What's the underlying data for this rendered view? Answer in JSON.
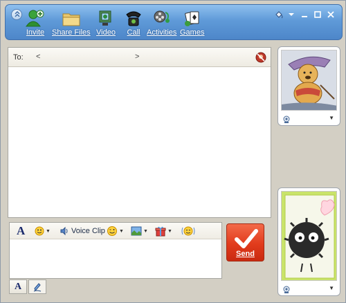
{
  "toolbar": {
    "buttons": [
      {
        "id": "invite",
        "label": "Invite",
        "icon": "add-contact-icon"
      },
      {
        "id": "share",
        "label": "Share Files",
        "icon": "folder-icon"
      },
      {
        "id": "video",
        "label": "Video",
        "icon": "video-icon"
      },
      {
        "id": "call",
        "label": "Call",
        "icon": "phone-icon"
      },
      {
        "id": "activities",
        "label": "Activities",
        "icon": "film-reel-icon"
      },
      {
        "id": "games",
        "label": "Games",
        "icon": "cards-icon"
      }
    ],
    "colors": {
      "top": "#8fc0ee",
      "bottom": "#4d86c9"
    }
  },
  "to_bar": {
    "label": "To:",
    "contact_open": "<",
    "contact_close": ">"
  },
  "format_bar": {
    "font_label": "A",
    "voice_clip_label": "Voice Clip"
  },
  "mode_tabs": {
    "text_mode": "A"
  },
  "send": {
    "label": "Send",
    "color": "#e13b1c"
  }
}
